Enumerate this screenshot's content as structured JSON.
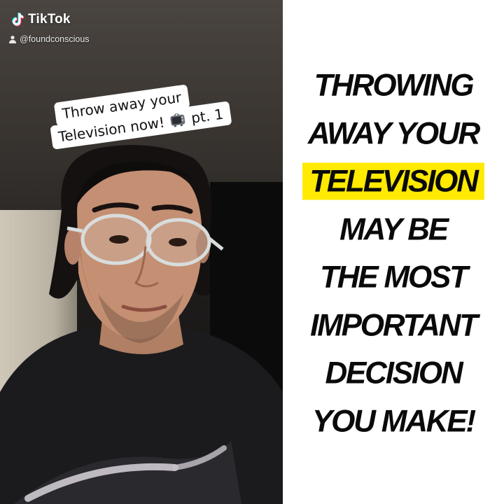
{
  "app": {
    "name": "TikTok",
    "logo_icon": "tiktok-note-icon"
  },
  "video": {
    "handle": "@foundconscious",
    "handle_icon": "user-icon",
    "caption": {
      "line1": "Throw away your",
      "line2_before": "Television now!",
      "line2_icon": "television-icon",
      "line2_after": "pt. 1"
    }
  },
  "headline": {
    "highlight_color": "#ffea00",
    "lines": [
      {
        "text": "THROWING",
        "highlight": false
      },
      {
        "text": "AWAY YOUR",
        "highlight": false
      },
      {
        "text": "TELEVISION",
        "highlight": true
      },
      {
        "text": "MAY BE",
        "highlight": false
      },
      {
        "text": "THE MOST",
        "highlight": false
      },
      {
        "text": "IMPORTANT",
        "highlight": false
      },
      {
        "text": "DECISION",
        "highlight": false
      },
      {
        "text": "YOU MAKE!",
        "highlight": false
      }
    ]
  }
}
